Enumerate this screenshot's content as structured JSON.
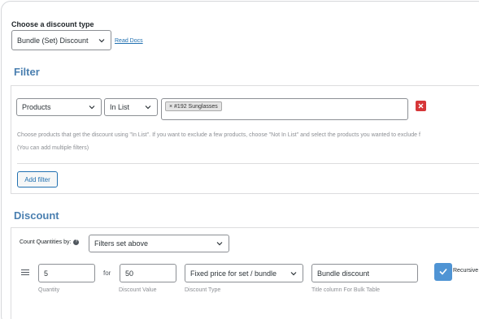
{
  "discount_type": {
    "label": "Choose a discount type",
    "selected": "Bundle (Set) Discount",
    "read_docs": "Read Docs"
  },
  "filter": {
    "title": "Filter",
    "type_selected": "Products",
    "method_selected": "In List",
    "tags": [
      "× #192 Sunglasses"
    ],
    "help_text": "Choose products that get the discount using \"In List\". If you want to exclude a few products, choose \"Not In List\" and select the products you wanted to exclude f",
    "help_note": "(You can add multiple filters)",
    "add_button": "Add filter"
  },
  "discount": {
    "title": "Discount",
    "count_label": "Count Quantities by:",
    "help_icon": "?",
    "count_selected": "Filters set above",
    "row": {
      "quantity": "5",
      "quantity_label": "Quantity",
      "for_text": "for",
      "value": "50",
      "value_label": "Discount Value",
      "type_selected": "Fixed price for set / bundle",
      "type_label": "Discount Type",
      "title_value": "Bundle discount",
      "title_label": "Title column For Bulk Table",
      "recursive_label": "Recursive",
      "recursive_checked": true
    }
  },
  "colors": {
    "section_title": "#4a7fb0",
    "link": "#2271b1",
    "remove": "#d63638",
    "checkbox": "#4f94d4"
  }
}
